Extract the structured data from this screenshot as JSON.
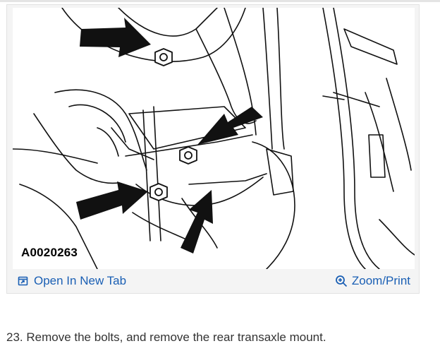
{
  "figure": {
    "figure_id": "A0020263",
    "image_alt": "Rear transaxle mount bolts diagram"
  },
  "actions": {
    "open_new_tab": {
      "label": "Open In New Tab",
      "icon": "open-external-icon"
    },
    "zoom_print": {
      "label": "Zoom/Print",
      "icon": "zoom-in-icon"
    }
  },
  "step": {
    "text": "23. Remove the bolts, and remove the rear transaxle mount."
  },
  "colors": {
    "link": "#1a5fb4",
    "card_background": "#f4f4f4",
    "body_text": "#333333"
  }
}
